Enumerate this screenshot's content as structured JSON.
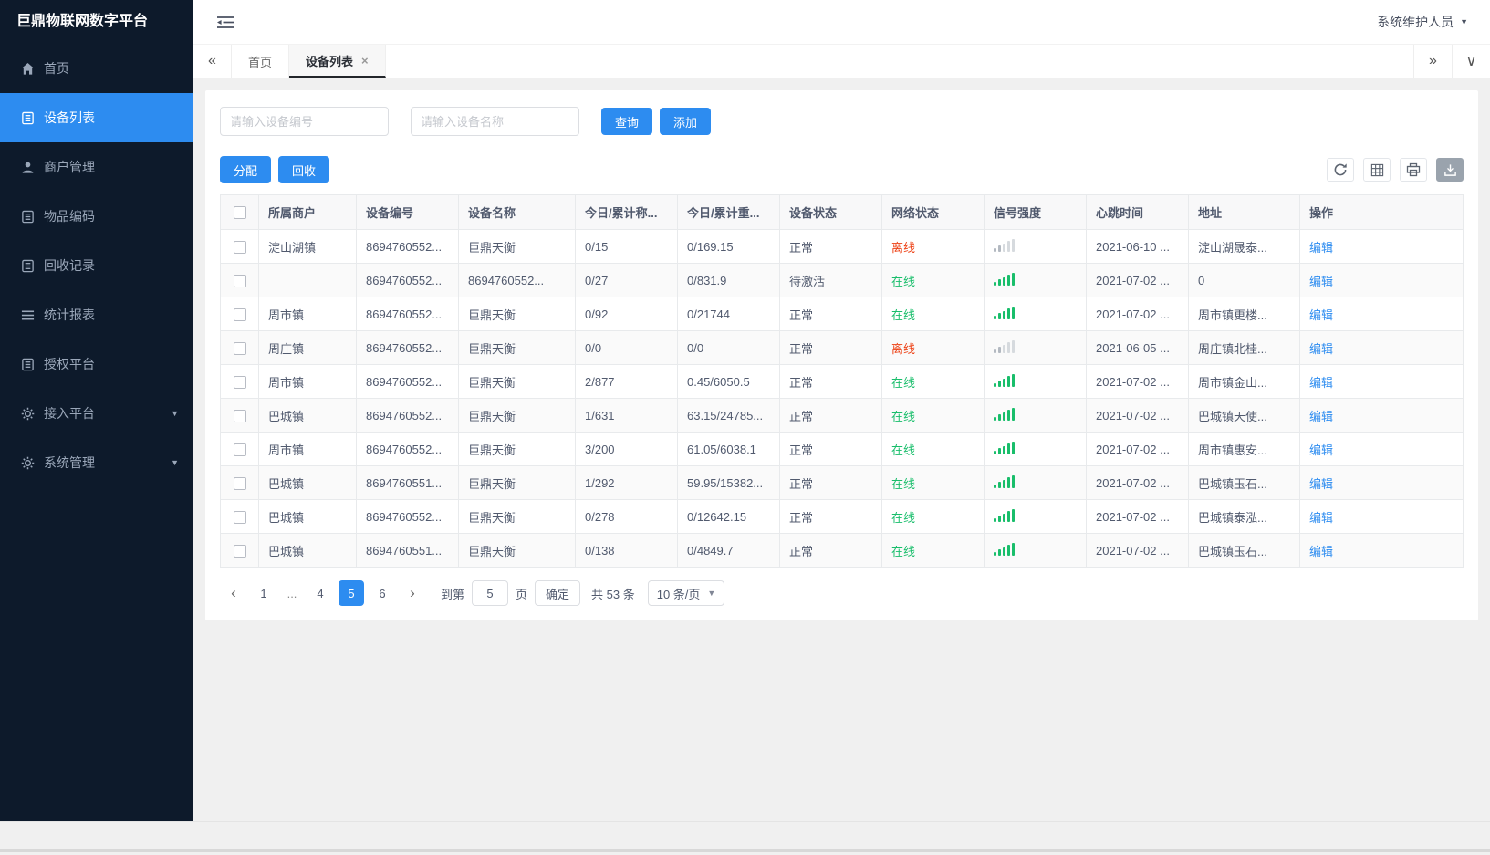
{
  "colors": {
    "primary": "#2d8cf0",
    "danger": "#ed4014",
    "success": "#19be6b",
    "sidebar_bg": "#0d1a2b"
  },
  "brand": {
    "title": "巨鼎物联网数字平台"
  },
  "topbar": {
    "user_name": "系统维护人员"
  },
  "sidebar": {
    "items": [
      {
        "id": "home",
        "label": "首页",
        "icon": "home"
      },
      {
        "id": "device-list",
        "label": "设备列表",
        "icon": "doc-list",
        "active": true
      },
      {
        "id": "merchant-mgmt",
        "label": "商户管理",
        "icon": "user"
      },
      {
        "id": "item-code",
        "label": "物品编码",
        "icon": "doc-list"
      },
      {
        "id": "recycle-record",
        "label": "回收记录",
        "icon": "doc-list"
      },
      {
        "id": "stats-report",
        "label": "统计报表",
        "icon": "lines"
      },
      {
        "id": "auth-platform",
        "label": "授权平台",
        "icon": "doc-list"
      },
      {
        "id": "access-platform",
        "label": "接入平台",
        "icon": "gear",
        "expandable": true
      },
      {
        "id": "system-mgmt",
        "label": "系统管理",
        "icon": "gear",
        "expandable": true
      }
    ]
  },
  "tabs": {
    "items": [
      {
        "id": "home",
        "label": "首页"
      },
      {
        "id": "device-list",
        "label": "设备列表",
        "active": true,
        "closable": true
      }
    ]
  },
  "search": {
    "device_no_placeholder": "请输入设备编号",
    "device_name_placeholder": "请输入设备名称",
    "query_label": "查询",
    "add_label": "添加"
  },
  "actions": {
    "assign_label": "分配",
    "recycle_label": "回收"
  },
  "table": {
    "headers": [
      "所属商户",
      "设备编号",
      "设备名称",
      "今日/累计称...",
      "今日/累计重...",
      "设备状态",
      "网络状态",
      "信号强度",
      "心跳时间",
      "地址",
      "操作"
    ],
    "edit_label": "编辑",
    "rows": [
      {
        "merchant": "淀山湖镇",
        "device_no": "8694760552...",
        "device_name": "巨鼎天衡",
        "today_total_count": "0/15",
        "today_total_weight": "0/169.15",
        "device_status": "正常",
        "network_status": "离线",
        "signal": "weak",
        "heartbeat": "2021-06-10 ...",
        "address": "淀山湖晟泰..."
      },
      {
        "merchant": "",
        "device_no": "8694760552...",
        "device_name": "8694760552...",
        "today_total_count": "0/27",
        "today_total_weight": "0/831.9",
        "device_status": "待激活",
        "network_status": "在线",
        "signal": "strong",
        "heartbeat": "2021-07-02 ...",
        "address": "0"
      },
      {
        "merchant": "周市镇",
        "device_no": "8694760552...",
        "device_name": "巨鼎天衡",
        "today_total_count": "0/92",
        "today_total_weight": "0/21744",
        "device_status": "正常",
        "network_status": "在线",
        "signal": "strong",
        "heartbeat": "2021-07-02 ...",
        "address": "周市镇更楼..."
      },
      {
        "merchant": "周庄镇",
        "device_no": "8694760552...",
        "device_name": "巨鼎天衡",
        "today_total_count": "0/0",
        "today_total_weight": "0/0",
        "device_status": "正常",
        "network_status": "离线",
        "signal": "weak",
        "heartbeat": "2021-06-05 ...",
        "address": "周庄镇北桂..."
      },
      {
        "merchant": "周市镇",
        "device_no": "8694760552...",
        "device_name": "巨鼎天衡",
        "today_total_count": "2/877",
        "today_total_weight": "0.45/6050.5",
        "device_status": "正常",
        "network_status": "在线",
        "signal": "strong",
        "heartbeat": "2021-07-02 ...",
        "address": "周市镇金山..."
      },
      {
        "merchant": "巴城镇",
        "device_no": "8694760552...",
        "device_name": "巨鼎天衡",
        "today_total_count": "1/631",
        "today_total_weight": "63.15/24785...",
        "device_status": "正常",
        "network_status": "在线",
        "signal": "strong",
        "heartbeat": "2021-07-02 ...",
        "address": "巴城镇天使..."
      },
      {
        "merchant": "周市镇",
        "device_no": "8694760552...",
        "device_name": "巨鼎天衡",
        "today_total_count": "3/200",
        "today_total_weight": "61.05/6038.1",
        "device_status": "正常",
        "network_status": "在线",
        "signal": "strong",
        "heartbeat": "2021-07-02 ...",
        "address": "周市镇惠安..."
      },
      {
        "merchant": "巴城镇",
        "device_no": "8694760551...",
        "device_name": "巨鼎天衡",
        "today_total_count": "1/292",
        "today_total_weight": "59.95/15382...",
        "device_status": "正常",
        "network_status": "在线",
        "signal": "strong",
        "heartbeat": "2021-07-02 ...",
        "address": "巴城镇玉石..."
      },
      {
        "merchant": "巴城镇",
        "device_no": "8694760552...",
        "device_name": "巨鼎天衡",
        "today_total_count": "0/278",
        "today_total_weight": "0/12642.15",
        "device_status": "正常",
        "network_status": "在线",
        "signal": "strong",
        "heartbeat": "2021-07-02 ...",
        "address": "巴城镇泰泓..."
      },
      {
        "merchant": "巴城镇",
        "device_no": "8694760551...",
        "device_name": "巨鼎天衡",
        "today_total_count": "0/138",
        "today_total_weight": "0/4849.7",
        "device_status": "正常",
        "network_status": "在线",
        "signal": "strong",
        "heartbeat": "2021-07-02 ...",
        "address": "巴城镇玉石..."
      }
    ]
  },
  "pagination": {
    "pages": [
      "1",
      "...",
      "4",
      "5",
      "6"
    ],
    "active_page": "5",
    "jump_prefix": "到第",
    "jump_value": "5",
    "jump_suffix": "页",
    "confirm_label": "确定",
    "total_label": "共 53 条",
    "per_page_label": "10 条/页"
  }
}
